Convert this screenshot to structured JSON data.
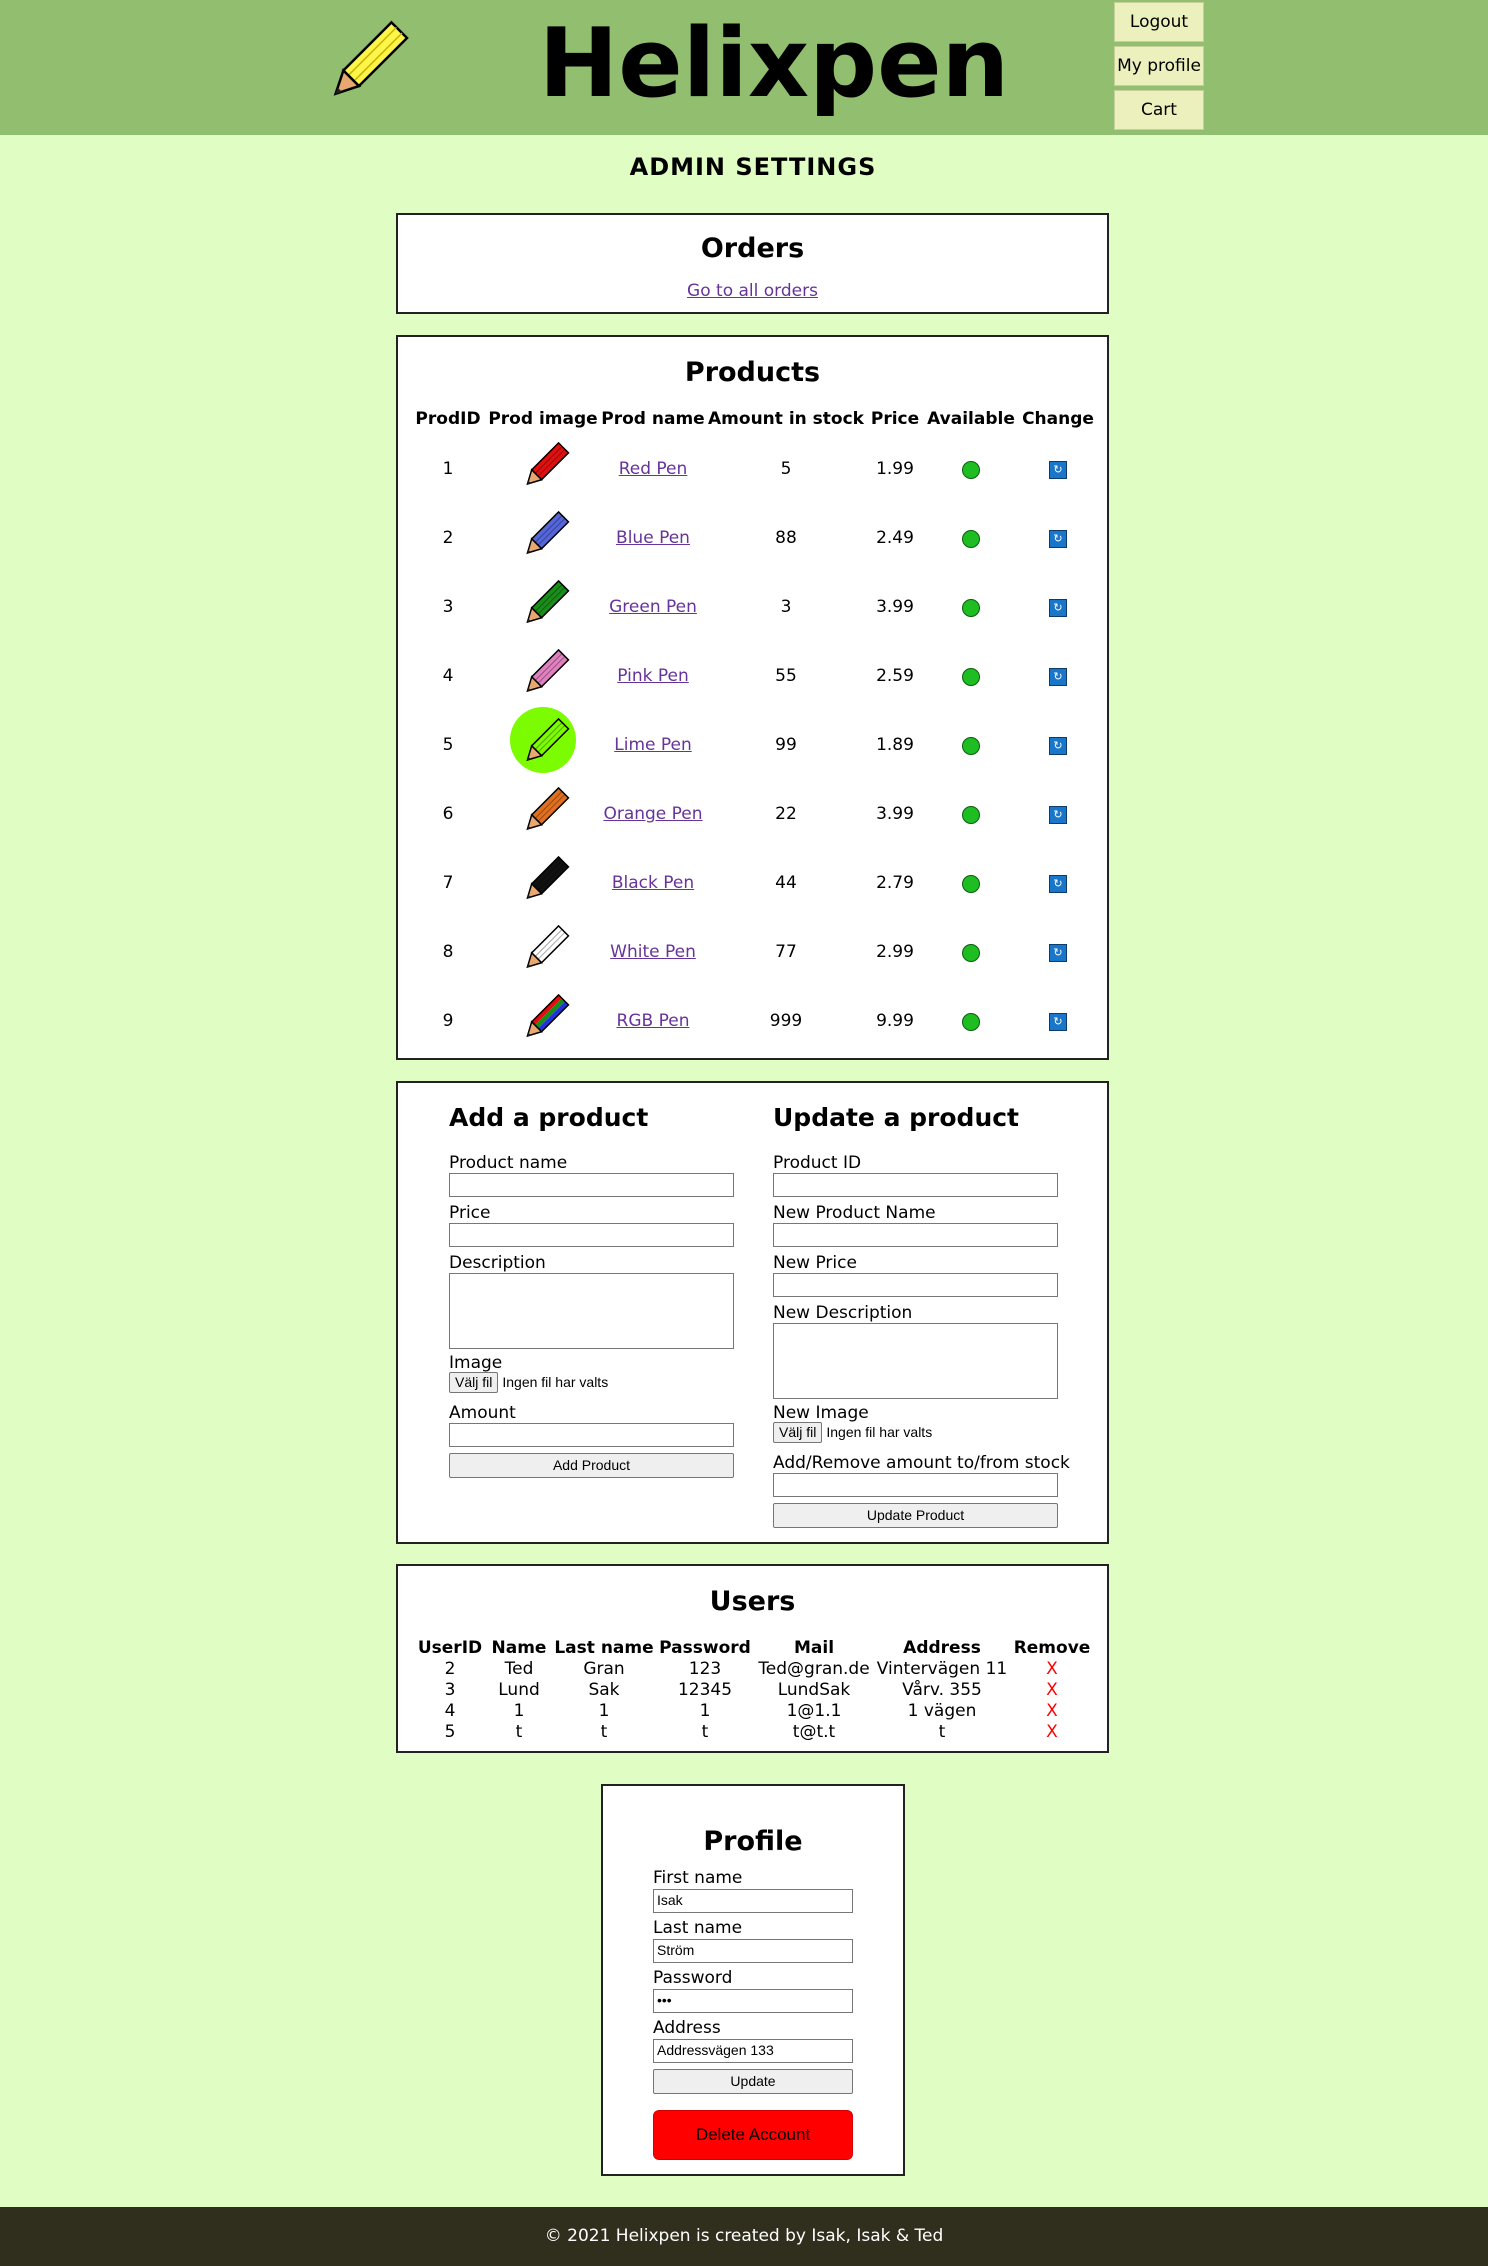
{
  "header": {
    "title": "Helixpen",
    "logo_icon": "pencil-logo-icon",
    "nav": {
      "logout": "Logout",
      "profile": "My profile",
      "cart": "Cart"
    }
  },
  "page_title": "ADMIN SETTINGS",
  "orders": {
    "title": "Orders",
    "link": "Go to all orders"
  },
  "products": {
    "title": "Products",
    "headers": [
      "ProdID",
      "Prod image",
      "Prod name",
      "Amount in stock",
      "Price",
      "Available",
      "Change"
    ],
    "rows": [
      {
        "id": "1",
        "name": "Red Pen",
        "stock": "5",
        "price": "1.99",
        "color": "#e01010"
      },
      {
        "id": "2",
        "name": "Blue Pen",
        "stock": "88",
        "price": "2.49",
        "color": "#5566dd"
      },
      {
        "id": "3",
        "name": "Green Pen",
        "stock": "3",
        "price": "3.99",
        "color": "#1a8c1a"
      },
      {
        "id": "4",
        "name": "Pink Pen",
        "stock": "55",
        "price": "2.59",
        "color": "#e080c0"
      },
      {
        "id": "5",
        "name": "Lime Pen",
        "stock": "99",
        "price": "1.89",
        "color": "#7cfc00"
      },
      {
        "id": "6",
        "name": "Orange Pen",
        "stock": "22",
        "price": "3.99",
        "color": "#e07020"
      },
      {
        "id": "7",
        "name": "Black Pen",
        "stock": "44",
        "price": "2.79",
        "color": "#111111"
      },
      {
        "id": "8",
        "name": "White Pen",
        "stock": "77",
        "price": "2.99",
        "color": "#ffffff"
      },
      {
        "id": "9",
        "name": "RGB Pen",
        "stock": "999",
        "price": "9.99",
        "color": "rgb"
      }
    ]
  },
  "add_product": {
    "title": "Add a product",
    "name_label": "Product name",
    "price_label": "Price",
    "description_label": "Description",
    "image_label": "Image",
    "file_button": "Välj fil",
    "file_status": "Ingen fil har valts",
    "amount_label": "Amount",
    "submit": "Add Product"
  },
  "update_product": {
    "title": "Update a product",
    "id_label": "Product ID",
    "name_label": "New Product Name",
    "price_label": "New Price",
    "description_label": "New Description",
    "image_label": "New Image",
    "file_button": "Välj fil",
    "file_status": "Ingen fil har valts",
    "amount_label": "Add/Remove amount to/from stock",
    "submit": "Update Product"
  },
  "users": {
    "title": "Users",
    "headers": [
      "UserID",
      "Name",
      "Last name",
      "Password",
      "Mail",
      "Address",
      "Remove"
    ],
    "rows": [
      {
        "id": "2",
        "name": "Ted",
        "last": "Gran",
        "password": "123",
        "mail": "Ted@gran.de",
        "address": "Vintervägen 11",
        "remove": "X"
      },
      {
        "id": "3",
        "name": "Lund",
        "last": "Sak",
        "password": "12345",
        "mail": "LundSak",
        "address": "Vårv. 355",
        "remove": "X"
      },
      {
        "id": "4",
        "name": "1",
        "last": "1",
        "password": "1",
        "mail": "1@1.1",
        "address": "1 vägen",
        "remove": "X"
      },
      {
        "id": "5",
        "name": "t",
        "last": "t",
        "password": "t",
        "mail": "t@t.t",
        "address": "t",
        "remove": "X"
      }
    ]
  },
  "profile": {
    "title": "Profile",
    "first_label": "First name",
    "first_value": "Isak",
    "last_label": "Last name",
    "last_value": "Ström",
    "password_label": "Password",
    "password_value": "•••",
    "address_label": "Address",
    "address_value": "Addressvägen 133",
    "update": "Update",
    "delete": "Delete Account"
  },
  "footer": "© 2021 Helixpen is created by Isak, Isak & Ted"
}
